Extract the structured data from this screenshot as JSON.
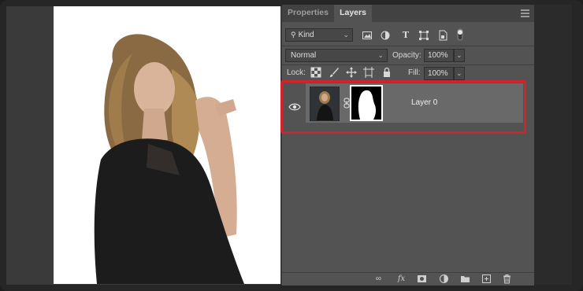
{
  "panel": {
    "tabs": [
      {
        "label": "Properties",
        "active": false
      },
      {
        "label": "Layers",
        "active": true
      }
    ],
    "filter": {
      "kind_label": "Kind"
    },
    "blend": {
      "mode": "Normal",
      "opacity_label": "Opacity:",
      "opacity_value": "100%"
    },
    "lock": {
      "label": "Lock:",
      "fill_label": "Fill:",
      "fill_value": "100%"
    },
    "layers": [
      {
        "name": "Layer 0",
        "visible": true,
        "has_mask": true
      }
    ]
  },
  "colors": {
    "highlight": "#d2232a",
    "panel_bg": "#535353",
    "layer_selected_bg": "#696969"
  },
  "icons": {
    "filter_row": [
      "search-icon",
      "image-filter-icon",
      "adjustment-filter-icon",
      "type-filter-icon",
      "shape-filter-icon",
      "smart-object-filter-icon",
      "filter-toggle-icon"
    ],
    "lock_row": [
      "lock-transparent-icon",
      "lock-image-icon",
      "lock-position-icon",
      "lock-artboard-icon",
      "lock-all-icon"
    ],
    "bottom_bar": [
      "link-layers-icon",
      "fx-icon",
      "add-mask-icon",
      "adjustment-layer-icon",
      "group-folder-icon",
      "new-layer-icon",
      "delete-icon"
    ]
  }
}
